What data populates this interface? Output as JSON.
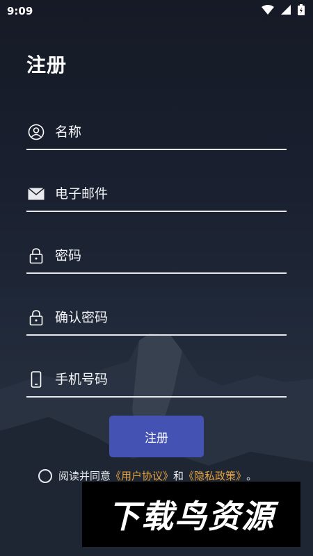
{
  "status_bar": {
    "time": "9:09"
  },
  "page": {
    "title": "注册"
  },
  "form": {
    "name_placeholder": "名称",
    "email_placeholder": "电子邮件",
    "password_placeholder": "密码",
    "confirm_password_placeholder": "确认密码",
    "phone_placeholder": "手机号码",
    "submit_label": "注册"
  },
  "agreement": {
    "prefix": "阅读并同意",
    "user_agreement": "《用户协议》",
    "conjunction": "和",
    "privacy_policy": "《隐私政策》",
    "suffix": "。",
    "checked": false
  },
  "watermark": {
    "text": "下载鸟资源"
  },
  "colors": {
    "primary_button": "#4453b3",
    "link": "#e6a23c",
    "underline": "#e6e8ec"
  },
  "icons": [
    "wifi-icon",
    "cellular-icon",
    "battery-icon",
    "person-icon",
    "mail-icon",
    "lock-icon",
    "phone-icon"
  ]
}
